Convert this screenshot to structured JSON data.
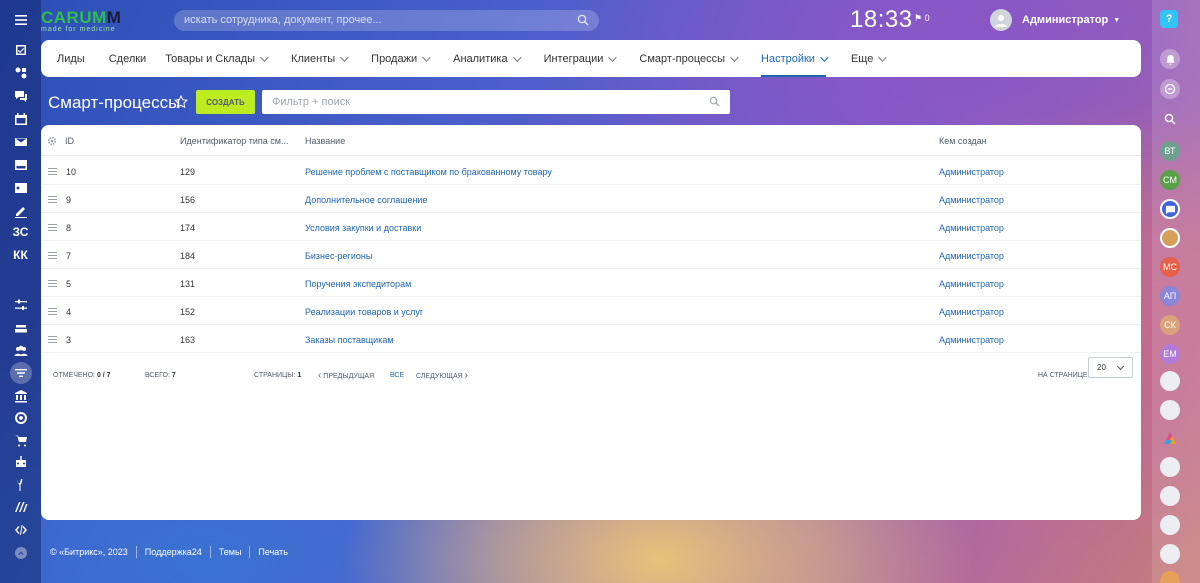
{
  "header": {
    "logo_main": "CARUMM",
    "logo_sub": "made for medicine",
    "search_placeholder": "искать сотрудника, документ, прочее...",
    "clock": "18:33",
    "flag_count": "0",
    "user_name": "Администратор"
  },
  "leftbar": {
    "text_items": [
      "ЗС",
      "КК"
    ]
  },
  "nav": {
    "items": [
      {
        "label": "Лиды",
        "dropdown": false
      },
      {
        "label": "Сделки",
        "dropdown": false
      },
      {
        "label": "Товары и Склады",
        "dropdown": true
      },
      {
        "label": "Клиенты",
        "dropdown": true
      },
      {
        "label": "Продажи",
        "dropdown": true
      },
      {
        "label": "Аналитика",
        "dropdown": true
      },
      {
        "label": "Интеграции",
        "dropdown": true
      },
      {
        "label": "Смарт-процессы",
        "dropdown": true
      },
      {
        "label": "Настройки",
        "dropdown": true,
        "active": true
      },
      {
        "label": "Еще",
        "dropdown": true
      }
    ]
  },
  "toolbar": {
    "title": "Смарт-процессы",
    "create_label": "СОЗДАТЬ",
    "filter_placeholder": "Фильтр + поиск"
  },
  "table": {
    "columns": [
      "ID",
      "Идентификатор типа см...",
      "Название",
      "Кем создан"
    ],
    "rows": [
      {
        "id": "10",
        "type_id": "129",
        "name": "Решение проблем с поставщиком по бракованному товару",
        "author": "Администратор"
      },
      {
        "id": "9",
        "type_id": "156",
        "name": "Дополнительное соглашение",
        "author": "Администратор"
      },
      {
        "id": "8",
        "type_id": "174",
        "name": "Условия закупки и доставки",
        "author": "Администратор"
      },
      {
        "id": "7",
        "type_id": "184",
        "name": "Бизнес-регионы",
        "author": "Администратор"
      },
      {
        "id": "5",
        "type_id": "131",
        "name": "Поручения экспедиторам",
        "author": "Администратор"
      },
      {
        "id": "4",
        "type_id": "152",
        "name": "Реализации товаров и услуг",
        "author": "Администратор"
      },
      {
        "id": "3",
        "type_id": "163",
        "name": "Заказы поставщикам",
        "author": "Администратор"
      }
    ]
  },
  "pager": {
    "selected_label": "ОТМЕЧЕНО:",
    "selected_value": "0 / 7",
    "total_label": "ВСЕГО:",
    "total_value": "7",
    "pages_label": "СТРАНИЦЫ:",
    "pages_value": "1",
    "prev_label": "ПРЕДЫДУЩАЯ",
    "all_label": "ВСЕ",
    "next_label": "СЛЕДУЮЩАЯ",
    "per_page_label": "НА СТРАНИЦЕ:",
    "per_page_value": "20"
  },
  "rightbar": {
    "avatars": [
      "ВТ",
      "СМ",
      "МС",
      "АП",
      "СК",
      "ЕМ"
    ]
  },
  "footer": {
    "copyright": "© «Битрикс», 2023",
    "support": "Поддержка24",
    "themes": "Темы",
    "print": "Печать"
  },
  "colors": {
    "accent": "#2067b0",
    "create_button": "#bbed21",
    "help_button": "#2fc6f6"
  }
}
